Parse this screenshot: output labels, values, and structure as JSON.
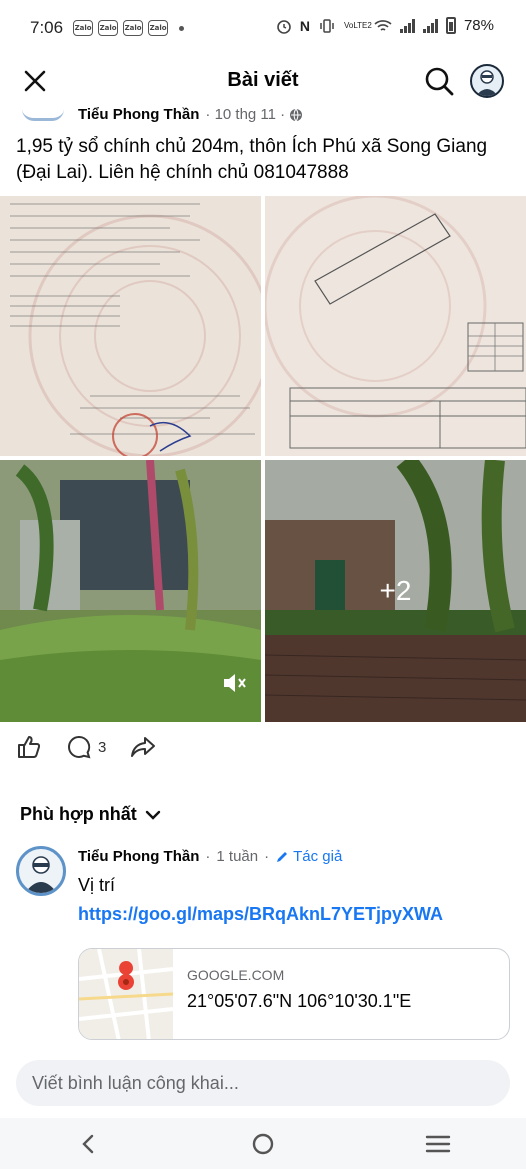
{
  "status": {
    "time": "7:06",
    "app_badges": [
      "Zalo",
      "Zalo",
      "Zalo",
      "Zalo"
    ],
    "network": "VoLTE2",
    "battery": "78%"
  },
  "header": {
    "title": "Bài viết"
  },
  "post": {
    "author": "Tiểu Phong Thần",
    "date": "10 thg 11",
    "text": "1,95 tỷ sổ chính chủ 204m, thôn Ích Phú xã Song Giang (Đại Lai). Liên hệ chính chủ 081047888",
    "more_photos": "+2",
    "comment_count": "3"
  },
  "comments_section": {
    "sort_label": "Phù hợp nhất"
  },
  "comment": {
    "author": "Tiểu Phong Thần",
    "time": "1 tuần",
    "author_badge": "Tác giả",
    "text": "Vị trí",
    "link": "https://goo.gl/maps/BRqAknL7YETjpyXWA",
    "preview_domain": "GOOGLE.COM",
    "preview_title": "21°05'07.6\"N 106°10'30.1\"E"
  },
  "composer": {
    "placeholder": "Viết bình luận công khai..."
  },
  "colors": {
    "link_blue": "#1877f2",
    "secondary_text": "#65676b",
    "composer_bg": "#f0f2f5"
  },
  "icons": [
    "close-icon",
    "search-icon",
    "like-icon",
    "comment-icon",
    "share-icon",
    "chevron-down-icon",
    "pencil-icon",
    "back-icon",
    "home-icon",
    "menu-icon",
    "mute-icon",
    "globe-icon"
  ]
}
